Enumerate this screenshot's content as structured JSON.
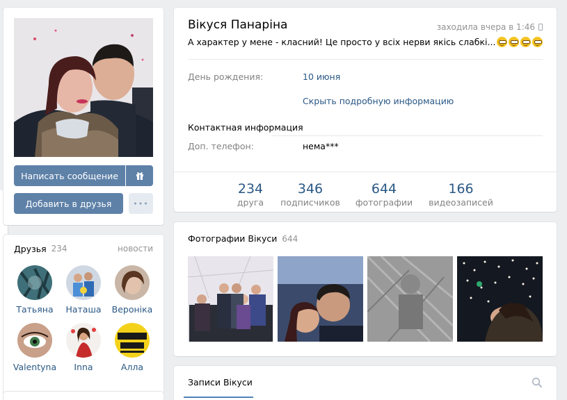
{
  "profile": {
    "name": "Вікуся Панаріна",
    "last_seen": "заходила вчера в 1:46",
    "status": "А характер у мене - класний! Це просто у всіх нерви якісь слабкі..."
  },
  "info": {
    "birthday_label": "День рождения:",
    "birthday_value": "10 июня",
    "toggle_link": "Скрыть подробную информацию",
    "contact_title": "Контактная информация",
    "phone_label": "Доп. телефон:",
    "phone_value": "нема***"
  },
  "counters": [
    {
      "value": "234",
      "label": "друга"
    },
    {
      "value": "346",
      "label": "подписчиков"
    },
    {
      "value": "644",
      "label": "фотографии"
    },
    {
      "value": "166",
      "label": "видеозаписей"
    }
  ],
  "actions": {
    "message": "Написать сообщение",
    "add_friend": "Добавить в друзья",
    "more": "•••"
  },
  "friends": {
    "title": "Друзья",
    "count": "234",
    "news": "новости",
    "items": [
      {
        "name": "Татьяна"
      },
      {
        "name": "Наташа"
      },
      {
        "name": "Вероніка"
      },
      {
        "name": "Valentyna"
      },
      {
        "name": "Inna"
      },
      {
        "name": "Алла"
      }
    ]
  },
  "photos": {
    "title": "Фотографии Вікуси",
    "count": "644"
  },
  "wall": {
    "tab": "Записи Вікуси"
  },
  "colors": {
    "accent": "#5e81a8",
    "link": "#2a5885",
    "background": "#edeef0"
  },
  "icons": [
    "gift-icon",
    "more-icon",
    "phone-icon",
    "search-icon",
    "emoji-icon"
  ]
}
